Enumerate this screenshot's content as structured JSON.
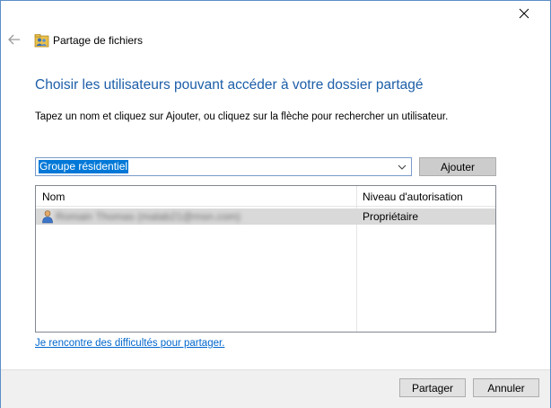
{
  "window": {
    "title": "Partage de fichiers",
    "close_icon": "close-icon",
    "back_icon": "back-arrow-icon",
    "title_icon": "users-folder-icon",
    "accent_color": "#1d5ea8"
  },
  "main": {
    "heading": "Choisir les utilisateurs pouvant accéder à votre dossier partagé",
    "instruction": "Tapez un nom et cliquez sur Ajouter, ou cliquez sur la flèche pour rechercher un utilisateur."
  },
  "picker": {
    "value": "Groupe résidentiel",
    "add_label": "Ajouter"
  },
  "table": {
    "columns": [
      "Nom",
      "Niveau d'autorisation"
    ],
    "rows": [
      {
        "name": "Romain Thomas (malab21@msn.com)",
        "level": "Propriétaire",
        "icon": "user-icon"
      }
    ]
  },
  "help": {
    "link": "Je rencontre des difficultés pour partager."
  },
  "footer": {
    "share_label": "Partager",
    "cancel_label": "Annuler"
  }
}
